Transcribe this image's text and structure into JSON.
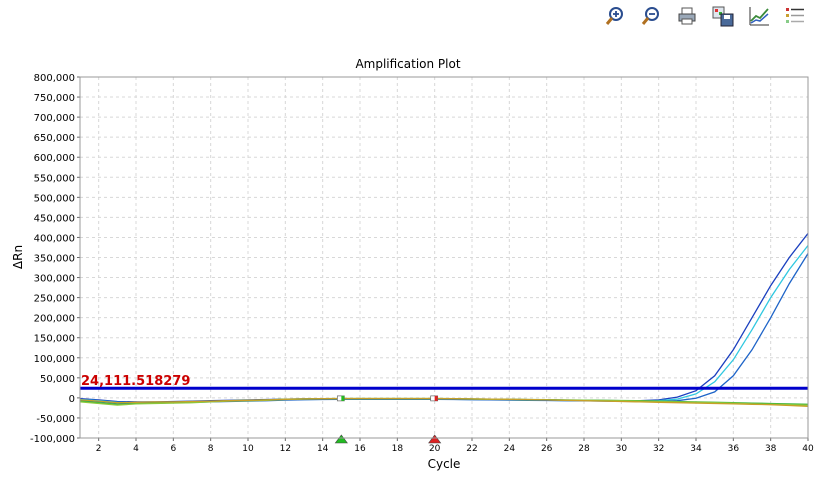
{
  "toolbar": {
    "icons": [
      "zoom-in-icon",
      "zoom-out-icon",
      "print-icon",
      "save-image-icon",
      "plot-settings-icon",
      "legend-icon"
    ]
  },
  "chart_data": {
    "type": "line",
    "title": "Amplification Plot",
    "xlabel": "Cycle",
    "ylabel": "ΔRn",
    "xlim": [
      1,
      40
    ],
    "ylim": [
      -100000,
      800000
    ],
    "xticks": [
      2,
      4,
      6,
      8,
      10,
      12,
      14,
      16,
      18,
      20,
      22,
      24,
      26,
      28,
      30,
      32,
      34,
      36,
      38,
      40
    ],
    "xtick_labels": [
      "2",
      "4",
      "6",
      "8",
      "10",
      "12",
      "14",
      "16",
      "18",
      "20",
      "22",
      "24",
      "26",
      "28",
      "30",
      "32",
      "34",
      "36",
      "38",
      "40"
    ],
    "yticks": [
      -100000,
      -50000,
      0,
      50000,
      100000,
      150000,
      200000,
      250000,
      300000,
      350000,
      400000,
      450000,
      500000,
      550000,
      600000,
      650000,
      700000,
      750000,
      800000
    ],
    "ytick_labels": [
      "-100,000",
      "-50,000",
      "0",
      "50,000",
      "100,000",
      "150,000",
      "200,000",
      "250,000",
      "300,000",
      "350,000",
      "400,000",
      "450,000",
      "500,000",
      "550,000",
      "600,000",
      "650,000",
      "700,000",
      "750,000",
      "800,000"
    ],
    "grid": true,
    "threshold": {
      "value": 24111.518279,
      "label": "24,111.518279",
      "color": "#0000cc"
    },
    "baseline_markers": [
      {
        "cycle": 15,
        "color": "#22bb22"
      },
      {
        "cycle": 20,
        "color": "#dd2222"
      }
    ],
    "x": [
      1,
      2,
      3,
      4,
      5,
      6,
      7,
      8,
      9,
      10,
      11,
      12,
      13,
      14,
      15,
      16,
      17,
      18,
      19,
      20,
      21,
      22,
      23,
      24,
      25,
      26,
      27,
      28,
      29,
      30,
      31,
      32,
      33,
      34,
      35,
      36,
      37,
      38,
      39,
      40
    ],
    "series": [
      {
        "color": "#1a3fbf",
        "values": [
          -2000,
          -5000,
          -9000,
          -10000,
          -10000,
          -9000,
          -8000,
          -7000,
          -6000,
          -5000,
          -4000,
          -3000,
          -2500,
          -2000,
          -2000,
          -2000,
          -2000,
          -2000,
          -2000,
          -2000,
          -2500,
          -3000,
          -3500,
          -4000,
          -4500,
          -5000,
          -5500,
          -6000,
          -6500,
          -7000,
          -7000,
          -5000,
          2000,
          18000,
          55000,
          120000,
          200000,
          280000,
          350000,
          410000
        ]
      },
      {
        "color": "#30c8e0",
        "values": [
          -4000,
          -7000,
          -11000,
          -12000,
          -12000,
          -11000,
          -10000,
          -9000,
          -8000,
          -7000,
          -6000,
          -5000,
          -4000,
          -3500,
          -3000,
          -3000,
          -3000,
          -3000,
          -3000,
          -3000,
          -3500,
          -4000,
          -4500,
          -5000,
          -5500,
          -6000,
          -6500,
          -7000,
          -7500,
          -8000,
          -8000,
          -7000,
          -3000,
          10000,
          40000,
          95000,
          170000,
          250000,
          320000,
          380000
        ]
      },
      {
        "color": "#1e64c8",
        "values": [
          -6000,
          -9000,
          -13000,
          -13000,
          -13000,
          -12000,
          -11000,
          -10000,
          -9000,
          -8000,
          -7000,
          -5500,
          -4500,
          -4000,
          -3500,
          -3500,
          -3500,
          -3500,
          -3500,
          -3500,
          -4000,
          -4500,
          -5000,
          -5500,
          -6000,
          -6500,
          -7000,
          -7500,
          -8000,
          -8500,
          -9000,
          -9000,
          -7000,
          -1000,
          15000,
          55000,
          120000,
          200000,
          285000,
          360000
        ]
      },
      {
        "color": "#3cb43c",
        "values": [
          -8000,
          -12000,
          -16000,
          -14000,
          -13000,
          -12000,
          -11000,
          -9000,
          -7000,
          -6000,
          -5000,
          -3000,
          -2500,
          -2000,
          -1500,
          -1500,
          -1500,
          -1500,
          -1500,
          -1500,
          -2000,
          -2500,
          -3000,
          -3500,
          -4000,
          -4500,
          -5000,
          -5500,
          -6000,
          -6500,
          -7000,
          -8000,
          -9000,
          -10000,
          -11000,
          -12000,
          -13000,
          -14000,
          -15000,
          -16000
        ]
      },
      {
        "color": "#8cc83c",
        "values": [
          -10000,
          -14000,
          -18000,
          -15000,
          -14000,
          -13000,
          -12000,
          -10000,
          -8000,
          -7000,
          -6000,
          -4000,
          -3000,
          -2500,
          -2000,
          -2000,
          -2000,
          -2000,
          -2000,
          -2000,
          -2500,
          -3000,
          -3500,
          -4000,
          -4500,
          -5000,
          -5500,
          -6000,
          -6500,
          -7000,
          -8000,
          -9000,
          -10000,
          -11000,
          -12000,
          -13000,
          -15000,
          -16000,
          -17000,
          -18000
        ]
      },
      {
        "color": "#c8a028",
        "values": [
          -5000,
          -8000,
          -12000,
          -11000,
          -10000,
          -10000,
          -9000,
          -8000,
          -7000,
          -6000,
          -5000,
          -3500,
          -2500,
          -2000,
          -1500,
          -1500,
          -1500,
          -1500,
          -1500,
          -1500,
          -2000,
          -2500,
          -3000,
          -3500,
          -4000,
          -5000,
          -6000,
          -7000,
          -8000,
          -9000,
          -10000,
          -11000,
          -12000,
          -13000,
          -14000,
          -15000,
          -16000,
          -17000,
          -19000,
          -21000
        ]
      }
    ]
  }
}
